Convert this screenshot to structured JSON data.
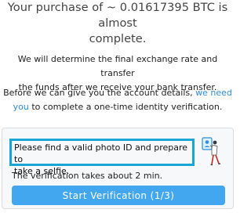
{
  "header": {
    "line1": "Your purchase of ~ 0.01617395 BTC is almost",
    "line2": "complete."
  },
  "info": {
    "line1": "We will determine the final exchange rate and transfer",
    "line2": "the funds after we receive your bank transfer.",
    "verify_l1_a": "Before we can give you the account details, ",
    "verify_link_1": "we need",
    "verify_link_2": "you",
    "verify_l2_b": " to complete a one-time identity verification."
  },
  "card": {
    "instruction_l1": "Please find a valid photo ID and prepare to",
    "instruction_l2": "take a selfie.",
    "duration_note": "The verification takes about 2 min.",
    "start_button_label": "Start Verification (1/3)"
  },
  "colors": {
    "accent": "#42a7ee",
    "link": "#2f8ed8",
    "highlight_border": "#1aa6d4"
  },
  "icons": {
    "illustration": "person-with-id-card-illustration"
  }
}
